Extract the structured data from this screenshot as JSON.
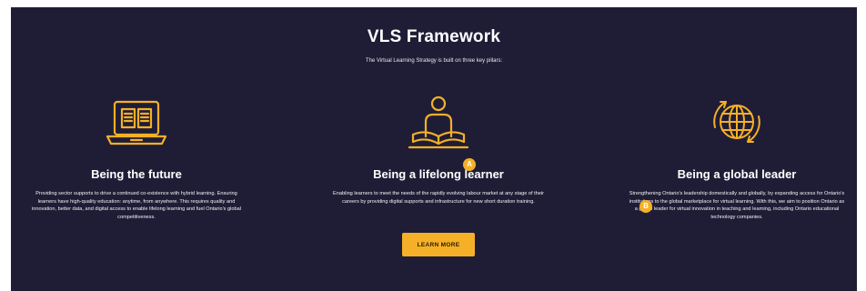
{
  "header": {
    "title": "VLS Framework",
    "subtitle": "The Virtual Learning Strategy is built on three key pillars:"
  },
  "pillars": [
    {
      "icon": "laptop-book-icon",
      "title": "Being the future",
      "description": "Providing sector supports to drive a continued co-existence with hybrid learning. Ensuring learners have high-quality education: anytime, from anywhere. This requires quality and innovation, better data, and digital access to enable lifelong learning and fuel Ontario's global competitiveness."
    },
    {
      "icon": "person-reading-icon",
      "title": "Being a lifelong learner",
      "description": "Enabling learners to meet the needs of the rapidly evolving labour market at any stage of their careers by providing digital supports and infrastructure for new short duration training."
    },
    {
      "icon": "globe-icon",
      "title": "Being a global leader",
      "description": "Strengthening Ontario's leadership domestically and globally, by expanding access for Ontario's institutions to the global marketplace for virtual learning. With this, we aim to position Ontario as a global leader for virtual innovation in teaching and learning, including Ontario educational technology companies."
    }
  ],
  "markers": {
    "a": "A",
    "b": "B"
  },
  "cta": {
    "label": "LEARN MORE"
  },
  "colors": {
    "background": "#1f1d36",
    "accent": "#f5b027",
    "text": "#ffffff"
  }
}
